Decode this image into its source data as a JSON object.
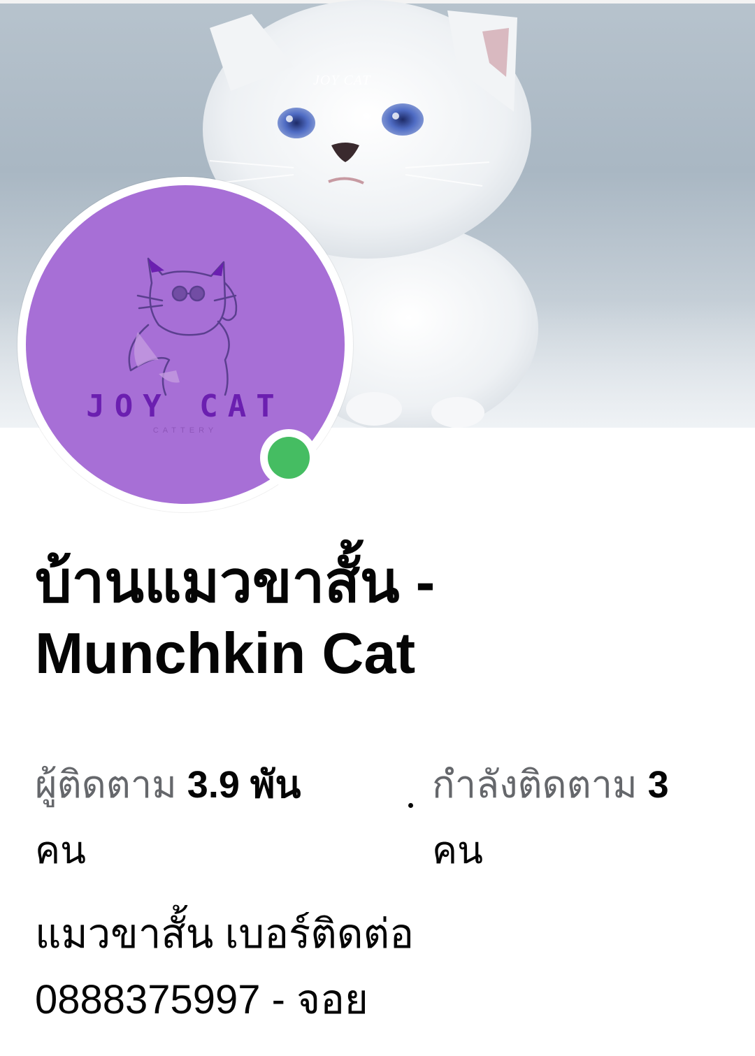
{
  "cover": {
    "watermark": "JOY CAT"
  },
  "avatar": {
    "brand": "JOY CAT",
    "brand_sub": "CATTERY",
    "background_color": "#a76fd6",
    "online_status_color": "#45bd62"
  },
  "profile": {
    "name": "บ้านแมวขาสั้น - Munchkin Cat",
    "followers_label": "ผู้ติดตาม",
    "followers_count": "3.9 พัน",
    "followers_unit": "คน",
    "following_label": "กำลังติดตาม",
    "following_count": "3",
    "following_unit": "คน",
    "bio_line1": "แมวขาสั้น เบอร์ติดต่อ",
    "bio_line2": "0888375997 - จอย"
  },
  "icons": [
    "online-status-icon",
    "separator-dot-icon"
  ]
}
